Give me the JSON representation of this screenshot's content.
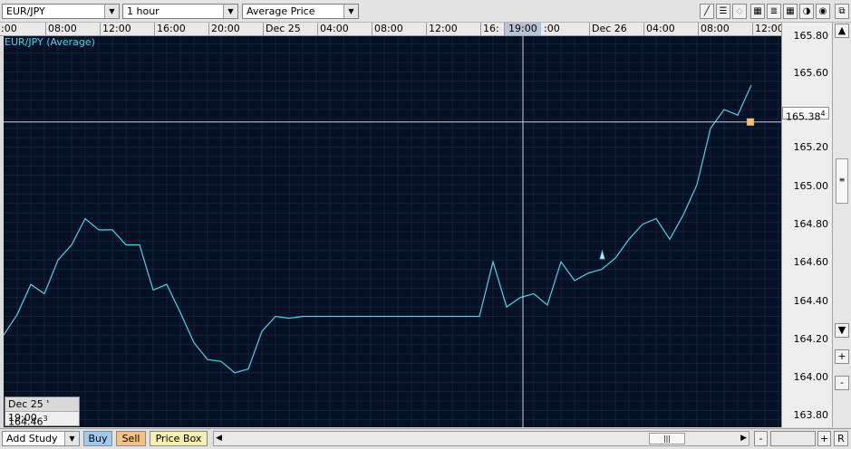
{
  "toolbar": {
    "symbol": "EUR/JPY",
    "interval": "1 hour",
    "price_type": "Average Price",
    "icons": [
      "line-tool-icon",
      "horizontal-lines-icon",
      "eraser-icon",
      "grid-icon",
      "list-icon",
      "circle-icon",
      "target-icon",
      "detach-window-icon"
    ]
  },
  "time_axis": {
    "ticks": [
      ":00",
      "08:00",
      "12:00",
      "16:00",
      "20:00",
      "Dec 25",
      "04:00",
      "08:00",
      "12:00",
      "16:",
      ":00",
      "Dec 26",
      "04:00",
      "08:00",
      "12:00"
    ],
    "crosshair_label": "19:00"
  },
  "legend": "EUR/JPY (Average)",
  "price_axis": {
    "labels": [
      "165.80",
      "165.60",
      "165.20",
      "165.00",
      "164.80",
      "164.60",
      "164.40",
      "164.20",
      "164.00",
      "163.80"
    ],
    "current_price": "165.38",
    "current_price_pip": "4"
  },
  "info_box": {
    "time": "Dec 25 ' 19:00",
    "value": "164.46",
    "value_pip": "3"
  },
  "bottom_bar": {
    "add_study": "Add Study",
    "buy": "Buy",
    "sell": "Sell",
    "price_box": "Price Box",
    "minus": "-",
    "plus": "+",
    "reset": "R"
  },
  "colors": {
    "chart_bg": "#061025",
    "line": "#3fd7e8",
    "grid": "#1d2c47",
    "buy": "#9ec8f0",
    "sell": "#f4c27e",
    "price_box": "#f7efb1"
  },
  "chart_data": {
    "type": "line",
    "title": "EUR/JPY (Average)",
    "x": [
      "Dec 24 06:00",
      "Dec 24 07:00",
      "Dec 24 08:00",
      "Dec 24 09:00",
      "Dec 24 10:00",
      "Dec 24 11:00",
      "Dec 24 12:00",
      "Dec 24 13:00",
      "Dec 24 14:00",
      "Dec 24 15:00",
      "Dec 24 16:00",
      "Dec 24 17:00",
      "Dec 24 18:00",
      "Dec 24 19:00",
      "Dec 24 20:00",
      "Dec 24 21:00",
      "Dec 24 22:00",
      "Dec 24 23:00",
      "Dec 25 00:00",
      "Dec 25 01:00",
      "Dec 25 02:00",
      "Dec 25 03:00",
      "Dec 25 04:00",
      "Dec 25 05:00",
      "Dec 25 06:00",
      "Dec 25 07:00",
      "Dec 25 08:00",
      "Dec 25 09:00",
      "Dec 25 10:00",
      "Dec 25 11:00",
      "Dec 25 12:00",
      "Dec 25 13:00",
      "Dec 25 14:00",
      "Dec 25 15:00",
      "Dec 25 16:00",
      "Dec 25 17:00",
      "Dec 25 18:00",
      "Dec 25 19:00",
      "Dec 25 20:00",
      "Dec 25 21:00",
      "Dec 25 22:00",
      "Dec 25 23:00",
      "Dec 26 00:00",
      "Dec 26 01:00",
      "Dec 26 02:00",
      "Dec 26 03:00",
      "Dec 26 04:00",
      "Dec 26 05:00",
      "Dec 26 06:00",
      "Dec 26 07:00",
      "Dec 26 08:00",
      "Dec 26 09:00",
      "Dec 26 10:00",
      "Dec 26 11:00"
    ],
    "values": [
      164.25,
      164.36,
      164.52,
      164.47,
      164.65,
      164.73,
      164.87,
      164.81,
      164.81,
      164.73,
      164.73,
      164.49,
      164.52,
      164.37,
      164.21,
      164.12,
      164.11,
      164.05,
      164.07,
      164.27,
      164.35,
      164.34,
      164.35,
      164.35,
      164.35,
      164.35,
      164.35,
      164.35,
      164.35,
      164.35,
      164.35,
      164.35,
      164.35,
      164.35,
      164.35,
      164.35,
      164.64,
      164.4,
      164.45,
      164.47,
      164.41,
      164.64,
      164.54,
      164.58,
      164.6,
      164.66,
      164.76,
      164.84,
      164.87,
      164.76,
      164.89,
      165.05,
      165.35,
      165.45,
      165.42,
      165.58
    ],
    "ylim": [
      163.76,
      165.84
    ],
    "ylabel": "",
    "xlabel": "",
    "grid": true
  }
}
